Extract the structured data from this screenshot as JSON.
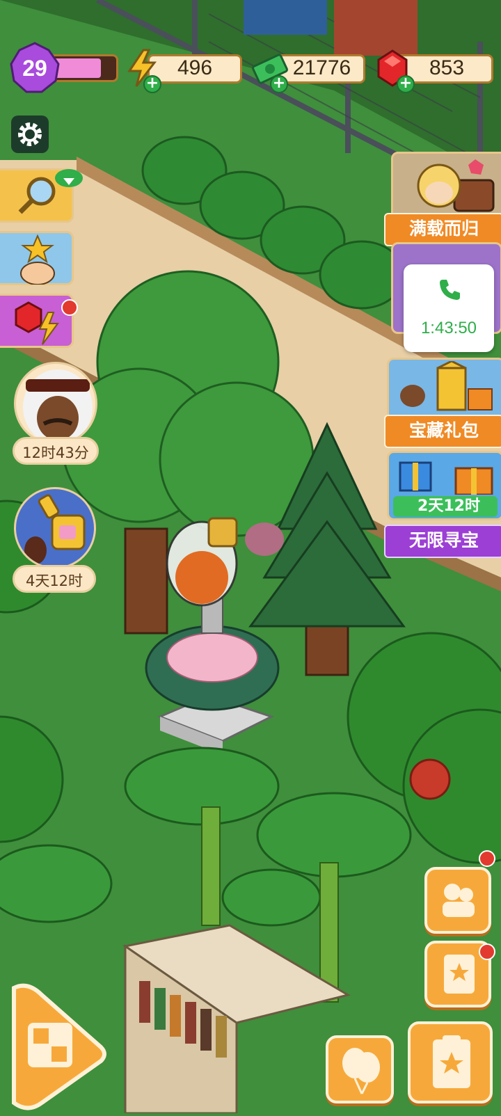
{
  "top_bar": {
    "level": "29",
    "energy": "496",
    "cash": "21776",
    "gems": "853"
  },
  "left_panel": {
    "npc_timer": "12时43分",
    "event_timer": "4天12时"
  },
  "right_panel": {
    "full_load_label": "满载而归",
    "call_timer": "1:43:50",
    "treasure_pack_label": "宝藏礼包",
    "infinite_treasure_timer": "2天12时",
    "infinite_treasure_label": "无限寻宝"
  },
  "colors": {
    "grass": "#3f8f3c",
    "path": "#e8cfa6",
    "accent_orange": "#f6a93a",
    "level_purple": "#a94bdc",
    "ribbon_orange": "#f08a25",
    "ribbon_purple": "#9c3fd4"
  },
  "icons": [
    "level-gem-icon",
    "lightning-icon",
    "cash-icon",
    "ruby-icon",
    "gear-icon",
    "magnifier-icon",
    "star-character-icon",
    "gem-lightning-icon",
    "phone-icon",
    "balloon-icon",
    "book-icon",
    "clipboard-star-icon",
    "family-icon",
    "merge-board-icon"
  ]
}
